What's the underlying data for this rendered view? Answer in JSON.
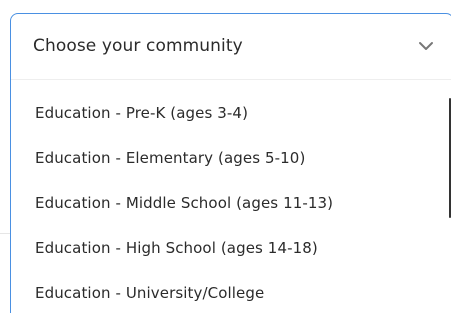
{
  "dropdown": {
    "selected_label": "Choose your community",
    "chevron_icon": "chevron-down-icon",
    "options": [
      {
        "label": "Education - Pre-K (ages 3-4)"
      },
      {
        "label": "Education - Elementary (ages 5-10)"
      },
      {
        "label": "Education - Middle School (ages 11-13)"
      },
      {
        "label": "Education - High School (ages 14-18)"
      },
      {
        "label": "Education - University/College"
      }
    ]
  },
  "colors": {
    "focus_border": "#4a90e2",
    "text": "#2b2b2b",
    "chevron": "#777777"
  }
}
